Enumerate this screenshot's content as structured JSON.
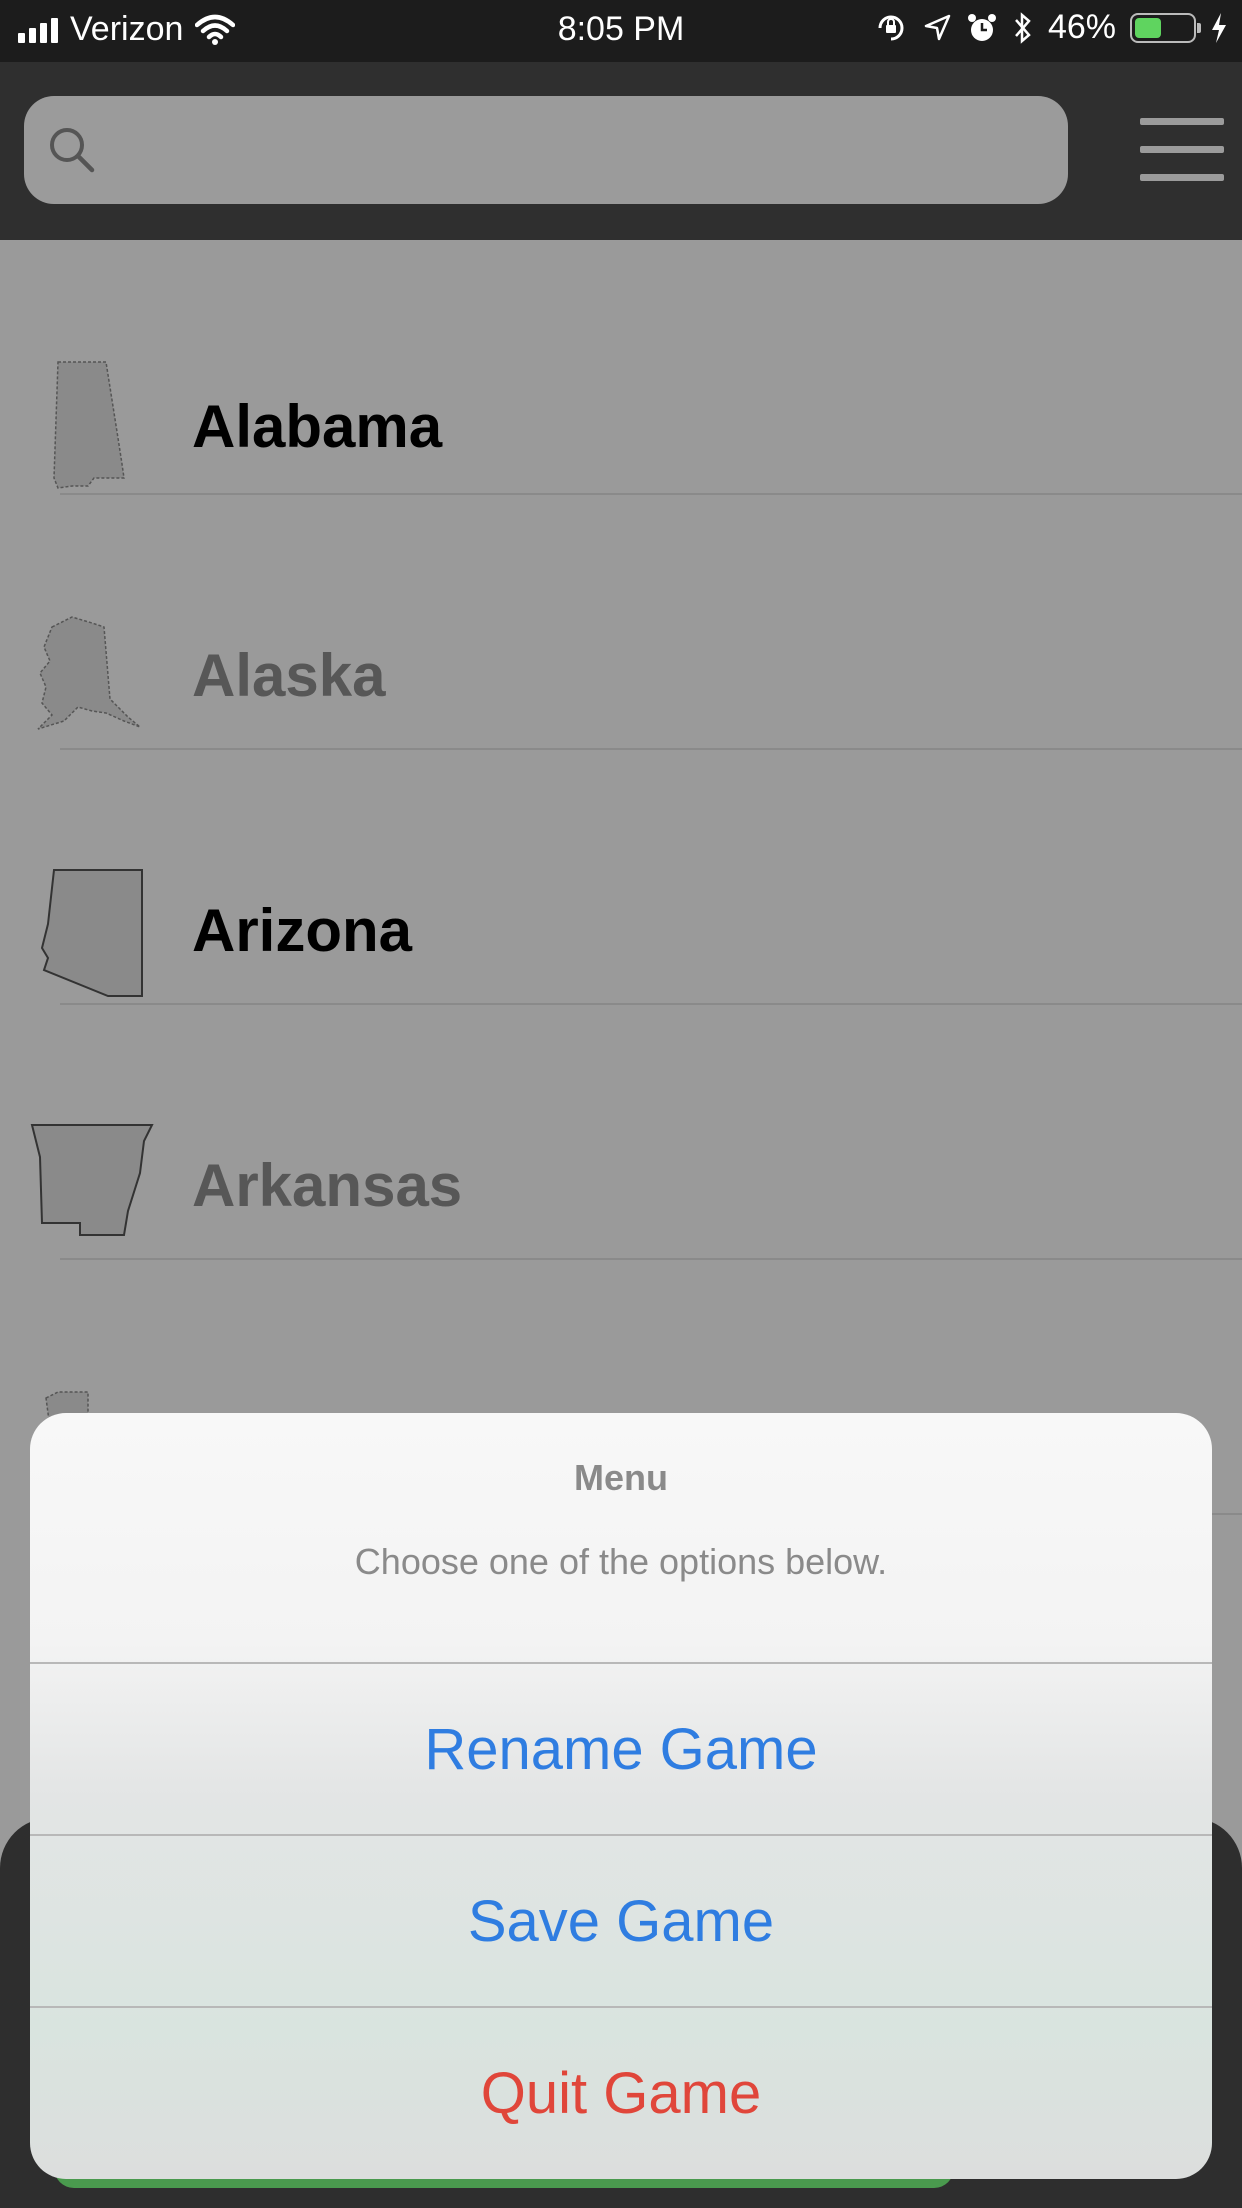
{
  "status_bar": {
    "carrier": "Verizon",
    "time": "8:05 PM",
    "battery_percent": "46%",
    "battery_level": 0.46
  },
  "search": {
    "placeholder": ""
  },
  "states": [
    {
      "name": "Alabama",
      "status": "done"
    },
    {
      "name": "Alaska",
      "status": "pending"
    },
    {
      "name": "Arizona",
      "status": "done"
    },
    {
      "name": "Arkansas",
      "status": "pending"
    }
  ],
  "sheet": {
    "title": "Menu",
    "message": "Choose one of the options below.",
    "actions": [
      {
        "label": "Rename Game",
        "style": "default"
      },
      {
        "label": "Save Game",
        "style": "default"
      },
      {
        "label": "Quit Game",
        "style": "destructive"
      }
    ]
  },
  "colors": {
    "action_blue": "#2f7de1",
    "action_red": "#e0463a",
    "battery_green": "#5fd45f"
  }
}
